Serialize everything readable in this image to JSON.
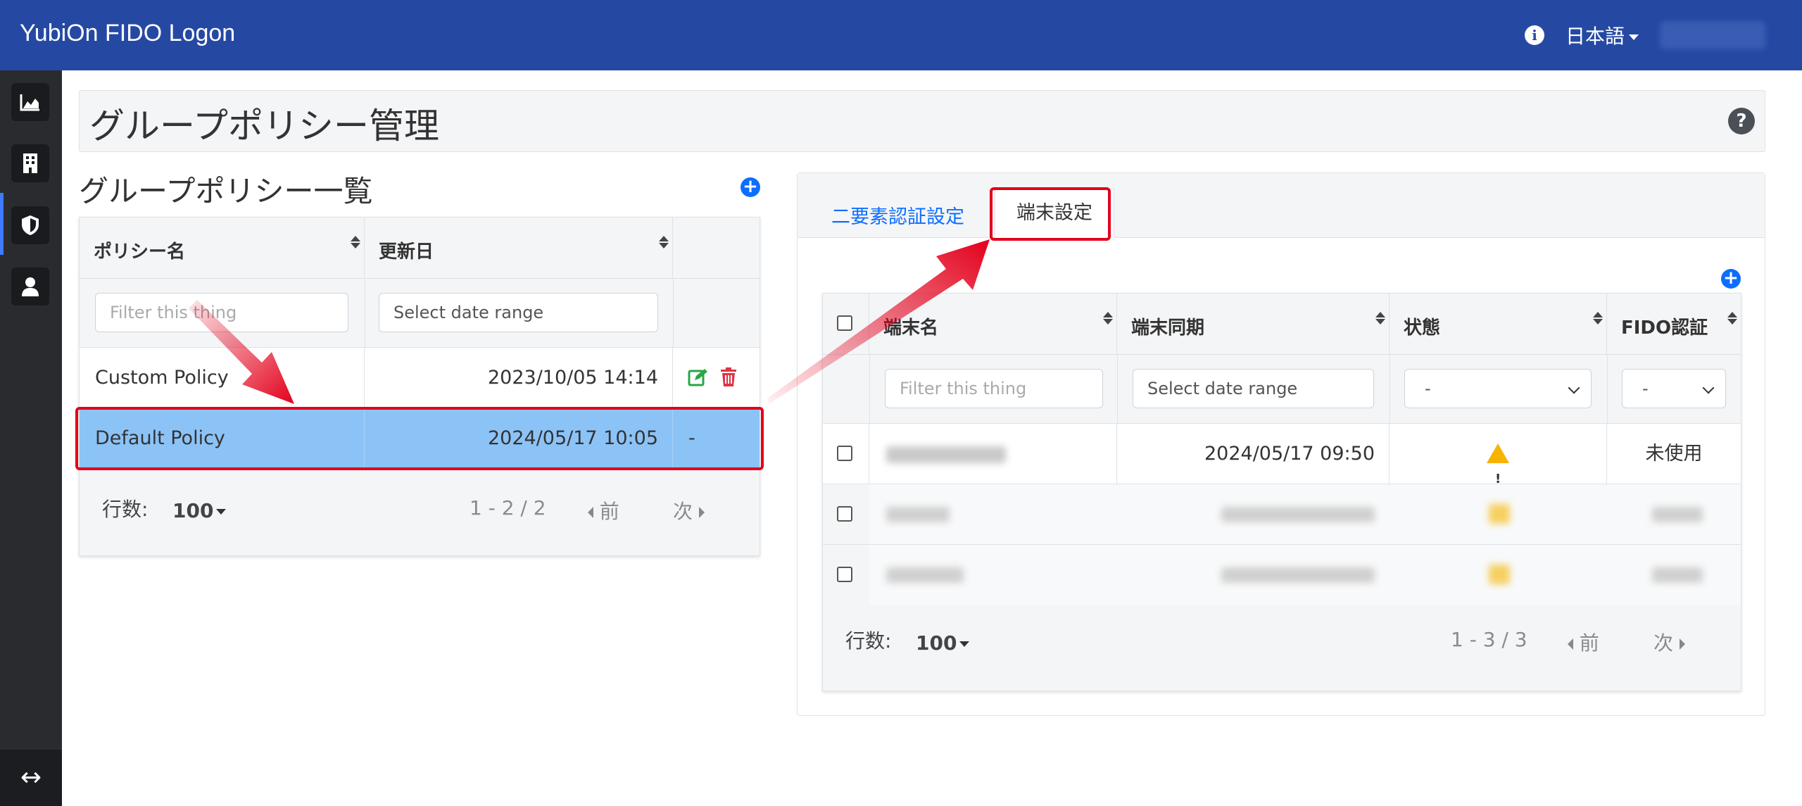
{
  "header": {
    "brand": "YubiOn FIDO Logon",
    "language": "日本語"
  },
  "sidebar": {
    "items": [
      "chart-icon",
      "building-icon",
      "shield-icon",
      "user-icon"
    ],
    "active_index": 2,
    "bottom_icon": "expand-arrows-icon",
    "bottom_glyph": "↔"
  },
  "page": {
    "title": "グループポリシー管理",
    "help_glyph": "?"
  },
  "policy_list": {
    "title": "グループポリシー一覧",
    "add_glyph": "+",
    "columns": [
      "ポリシー名",
      "更新日",
      ""
    ],
    "filter_placeholder": "Filter this thing",
    "date_placeholder": "Select date range",
    "rows": [
      {
        "name": "Custom Policy",
        "updated": "2023/10/05 14:14",
        "actions": "edit-delete"
      },
      {
        "name": "Default Policy",
        "updated": "2024/05/17 10:05",
        "actions": "-",
        "selected": true
      }
    ],
    "pager": {
      "rows_label": "行数:",
      "page_size": "100",
      "range": "1 - 2 / 2",
      "prev": "前",
      "next": "次"
    }
  },
  "right_panel": {
    "tabs": [
      {
        "label": "二要素認証設定",
        "active": false
      },
      {
        "label": "端末設定",
        "active": true
      }
    ],
    "device_table": {
      "columns": [
        "端末名",
        "端末同期",
        "状態",
        "FIDO認証"
      ],
      "filter_placeholder": "Filter this thing",
      "date_placeholder": "Select date range",
      "select_default": "-",
      "rows": [
        {
          "device": "",
          "synced": "2024/05/17 09:50",
          "status": "warning-icon",
          "fido": "未使用"
        },
        {
          "device": "",
          "synced": "",
          "status": "warning-icon",
          "fido": ""
        },
        {
          "device": "",
          "synced": "",
          "status": "warning-icon",
          "fido": ""
        }
      ],
      "pager": {
        "rows_label": "行数:",
        "page_size": "100",
        "range": "1 - 3 / 3",
        "prev": "前",
        "next": "次"
      }
    }
  },
  "colors": {
    "navbar": "#2549a3",
    "sidebar": "#2a2b2f",
    "selected_row": "#8cc3f7",
    "highlight": "#e3001b",
    "link": "#0d6efd"
  }
}
